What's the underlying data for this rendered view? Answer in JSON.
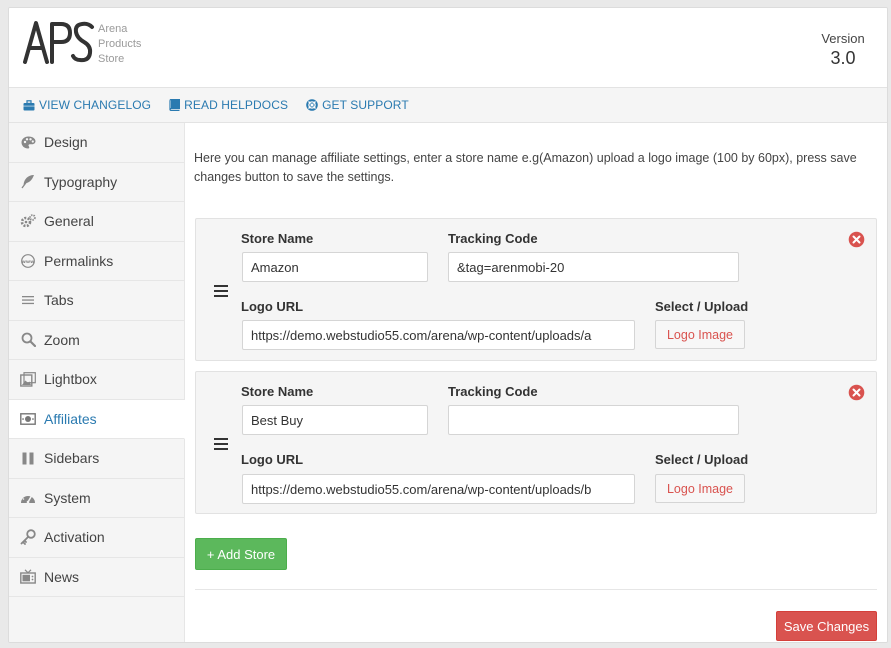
{
  "header": {
    "logo_mark": "APS",
    "logo_lines": [
      "Arena",
      "Products",
      "Store"
    ],
    "version_label": "Version",
    "version_number": "3.0"
  },
  "links": [
    {
      "label": "VIEW CHANGELOG",
      "icon": "briefcase-icon"
    },
    {
      "label": "READ HELPDOCS",
      "icon": "book-icon"
    },
    {
      "label": "GET SUPPORT",
      "icon": "lifebuoy-icon"
    }
  ],
  "sidebar": {
    "items": [
      {
        "label": "Design",
        "icon": "palette-icon"
      },
      {
        "label": "Typography",
        "icon": "feather-icon"
      },
      {
        "label": "General",
        "icon": "gears-icon"
      },
      {
        "label": "Permalinks",
        "icon": "www-icon"
      },
      {
        "label": "Tabs",
        "icon": "menu-lines-icon"
      },
      {
        "label": "Zoom",
        "icon": "magnifier-icon"
      },
      {
        "label": "Lightbox",
        "icon": "lightbox-icon"
      },
      {
        "label": "Affiliates",
        "icon": "money-icon",
        "active": true
      },
      {
        "label": "Sidebars",
        "icon": "columns-icon"
      },
      {
        "label": "System",
        "icon": "dashboard-icon"
      },
      {
        "label": "Activation",
        "icon": "key-icon"
      },
      {
        "label": "News",
        "icon": "tv-icon"
      }
    ]
  },
  "main": {
    "intro": "Here you can manage affiliate settings, enter a store name e.g(Amazon) upload a logo image (100 by 60px), press save changes button to save the settings.",
    "labels": {
      "store_name": "Store Name",
      "tracking_code": "Tracking Code",
      "logo_url": "Logo URL",
      "select_upload": "Select / Upload",
      "logo_image_button": "Logo Image"
    },
    "stores": [
      {
        "store_name": "Amazon",
        "tracking_code": "&tag=arenmobi-20",
        "logo_url": "https://demo.webstudio55.com/arena/wp-content/uploads/a"
      },
      {
        "store_name": "Best Buy",
        "tracking_code": "",
        "logo_url": "https://demo.webstudio55.com/arena/wp-content/uploads/b"
      }
    ],
    "add_store_label": "+ Add Store",
    "save_label": "Save Changes"
  },
  "colors": {
    "link": "#2a7ab0",
    "add_button": "#5cb85c",
    "save_button": "#d9534f",
    "remove_icon": "#d9534f"
  }
}
